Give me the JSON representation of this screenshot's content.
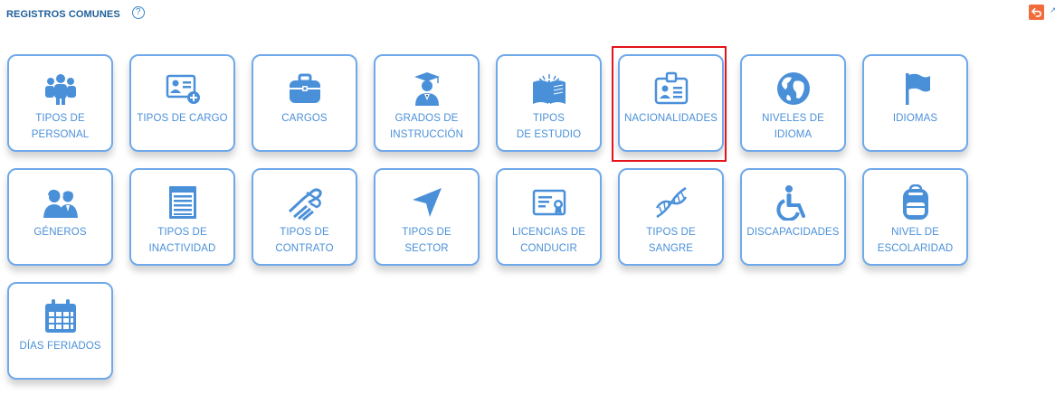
{
  "header": {
    "title": "REGISTROS COMUNES",
    "help_glyph": "?"
  },
  "colors": {
    "accent": "#4a90d9",
    "tile_border": "#6fa9ea",
    "title": "#1f5f9a",
    "back_button": "#f26b3a",
    "highlight": "#e3141a"
  },
  "tiles": [
    {
      "icon": "group-icon",
      "lines": [
        "TIPOS DE",
        "PERSONAL"
      ]
    },
    {
      "icon": "id-card-add-icon",
      "lines": [
        "TIPOS DE CARGO"
      ]
    },
    {
      "icon": "briefcase-icon",
      "lines": [
        "CARGOS"
      ]
    },
    {
      "icon": "graduate-icon",
      "lines": [
        "GRADOS DE",
        "INSTRUCCIÓN"
      ]
    },
    {
      "icon": "open-book-icon",
      "lines": [
        "TIPOS",
        "DE ESTUDIO"
      ]
    },
    {
      "icon": "id-badge-icon",
      "lines": [
        "NACIONALIDADES"
      ],
      "highlighted": true
    },
    {
      "icon": "globe-icon",
      "lines": [
        "NIVELES DE",
        "IDIOMA"
      ]
    },
    {
      "icon": "flag-icon",
      "lines": [
        "IDIOMAS"
      ]
    },
    {
      "icon": "people-icon",
      "lines": [
        "GÉNEROS"
      ]
    },
    {
      "icon": "document-list-icon",
      "lines": [
        "TIPOS DE",
        "INACTIVIDAD"
      ]
    },
    {
      "icon": "handshake-icon",
      "lines": [
        "TIPOS DE",
        "CONTRATO"
      ]
    },
    {
      "icon": "location-arrow-icon",
      "lines": [
        "TIPOS DE",
        "SECTOR"
      ]
    },
    {
      "icon": "certificate-icon",
      "lines": [
        "LICENCIAS DE",
        "CONDUCIR"
      ]
    },
    {
      "icon": "dna-icon",
      "lines": [
        "TIPOS DE",
        "SANGRE"
      ]
    },
    {
      "icon": "wheelchair-icon",
      "lines": [
        "DISCAPACIDADES"
      ]
    },
    {
      "icon": "backpack-icon",
      "lines": [
        "NIVEL DE",
        "ESCOLARIDAD"
      ]
    },
    {
      "icon": "calendar-icon",
      "lines": [
        "DÍAS FERIADOS"
      ]
    }
  ]
}
